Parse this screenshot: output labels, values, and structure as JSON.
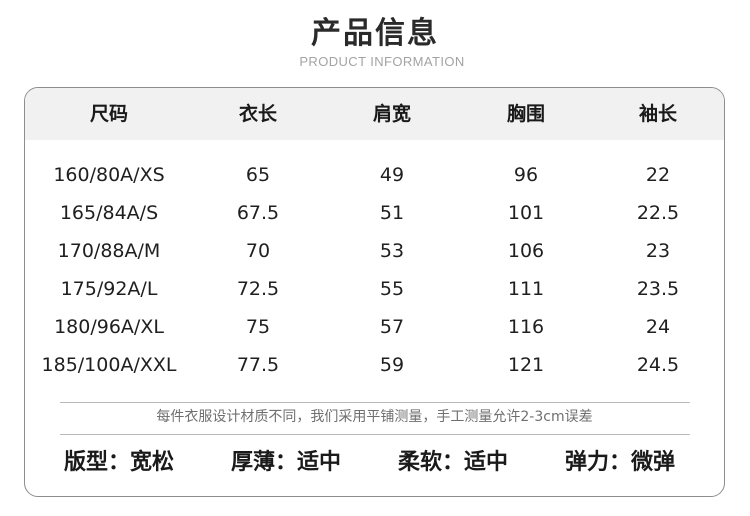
{
  "title": "产品信息",
  "subtitle": "PRODUCT INFORMATION",
  "table": {
    "headers": [
      "尺码",
      "衣长",
      "肩宽",
      "胸围",
      "袖长"
    ],
    "rows": [
      [
        "160/80A/XS",
        "65",
        "49",
        "96",
        "22"
      ],
      [
        "165/84A/S",
        "67.5",
        "51",
        "101",
        "22.5"
      ],
      [
        "170/88A/M",
        "70",
        "53",
        "106",
        "23"
      ],
      [
        "175/92A/L",
        "72.5",
        "55",
        "111",
        "23.5"
      ],
      [
        "180/96A/XL",
        "75",
        "57",
        "116",
        "24"
      ],
      [
        "185/100A/XXL",
        "77.5",
        "59",
        "121",
        "24.5"
      ]
    ]
  },
  "note": "每件衣服设计材质不同，我们采用平铺测量，手工测量允许2-3cm误差",
  "attributes": [
    {
      "label": "版型：",
      "value": "宽松"
    },
    {
      "label": "厚薄：",
      "value": "适中"
    },
    {
      "label": "柔软：",
      "value": "适中"
    },
    {
      "label": "弹力：",
      "value": "微弹"
    }
  ],
  "colors": {
    "header_band": "#f1f1f1",
    "border": "#8d8d8d",
    "note_text": "#6f6f6f",
    "subtitle_text": "#a3a3a3"
  }
}
